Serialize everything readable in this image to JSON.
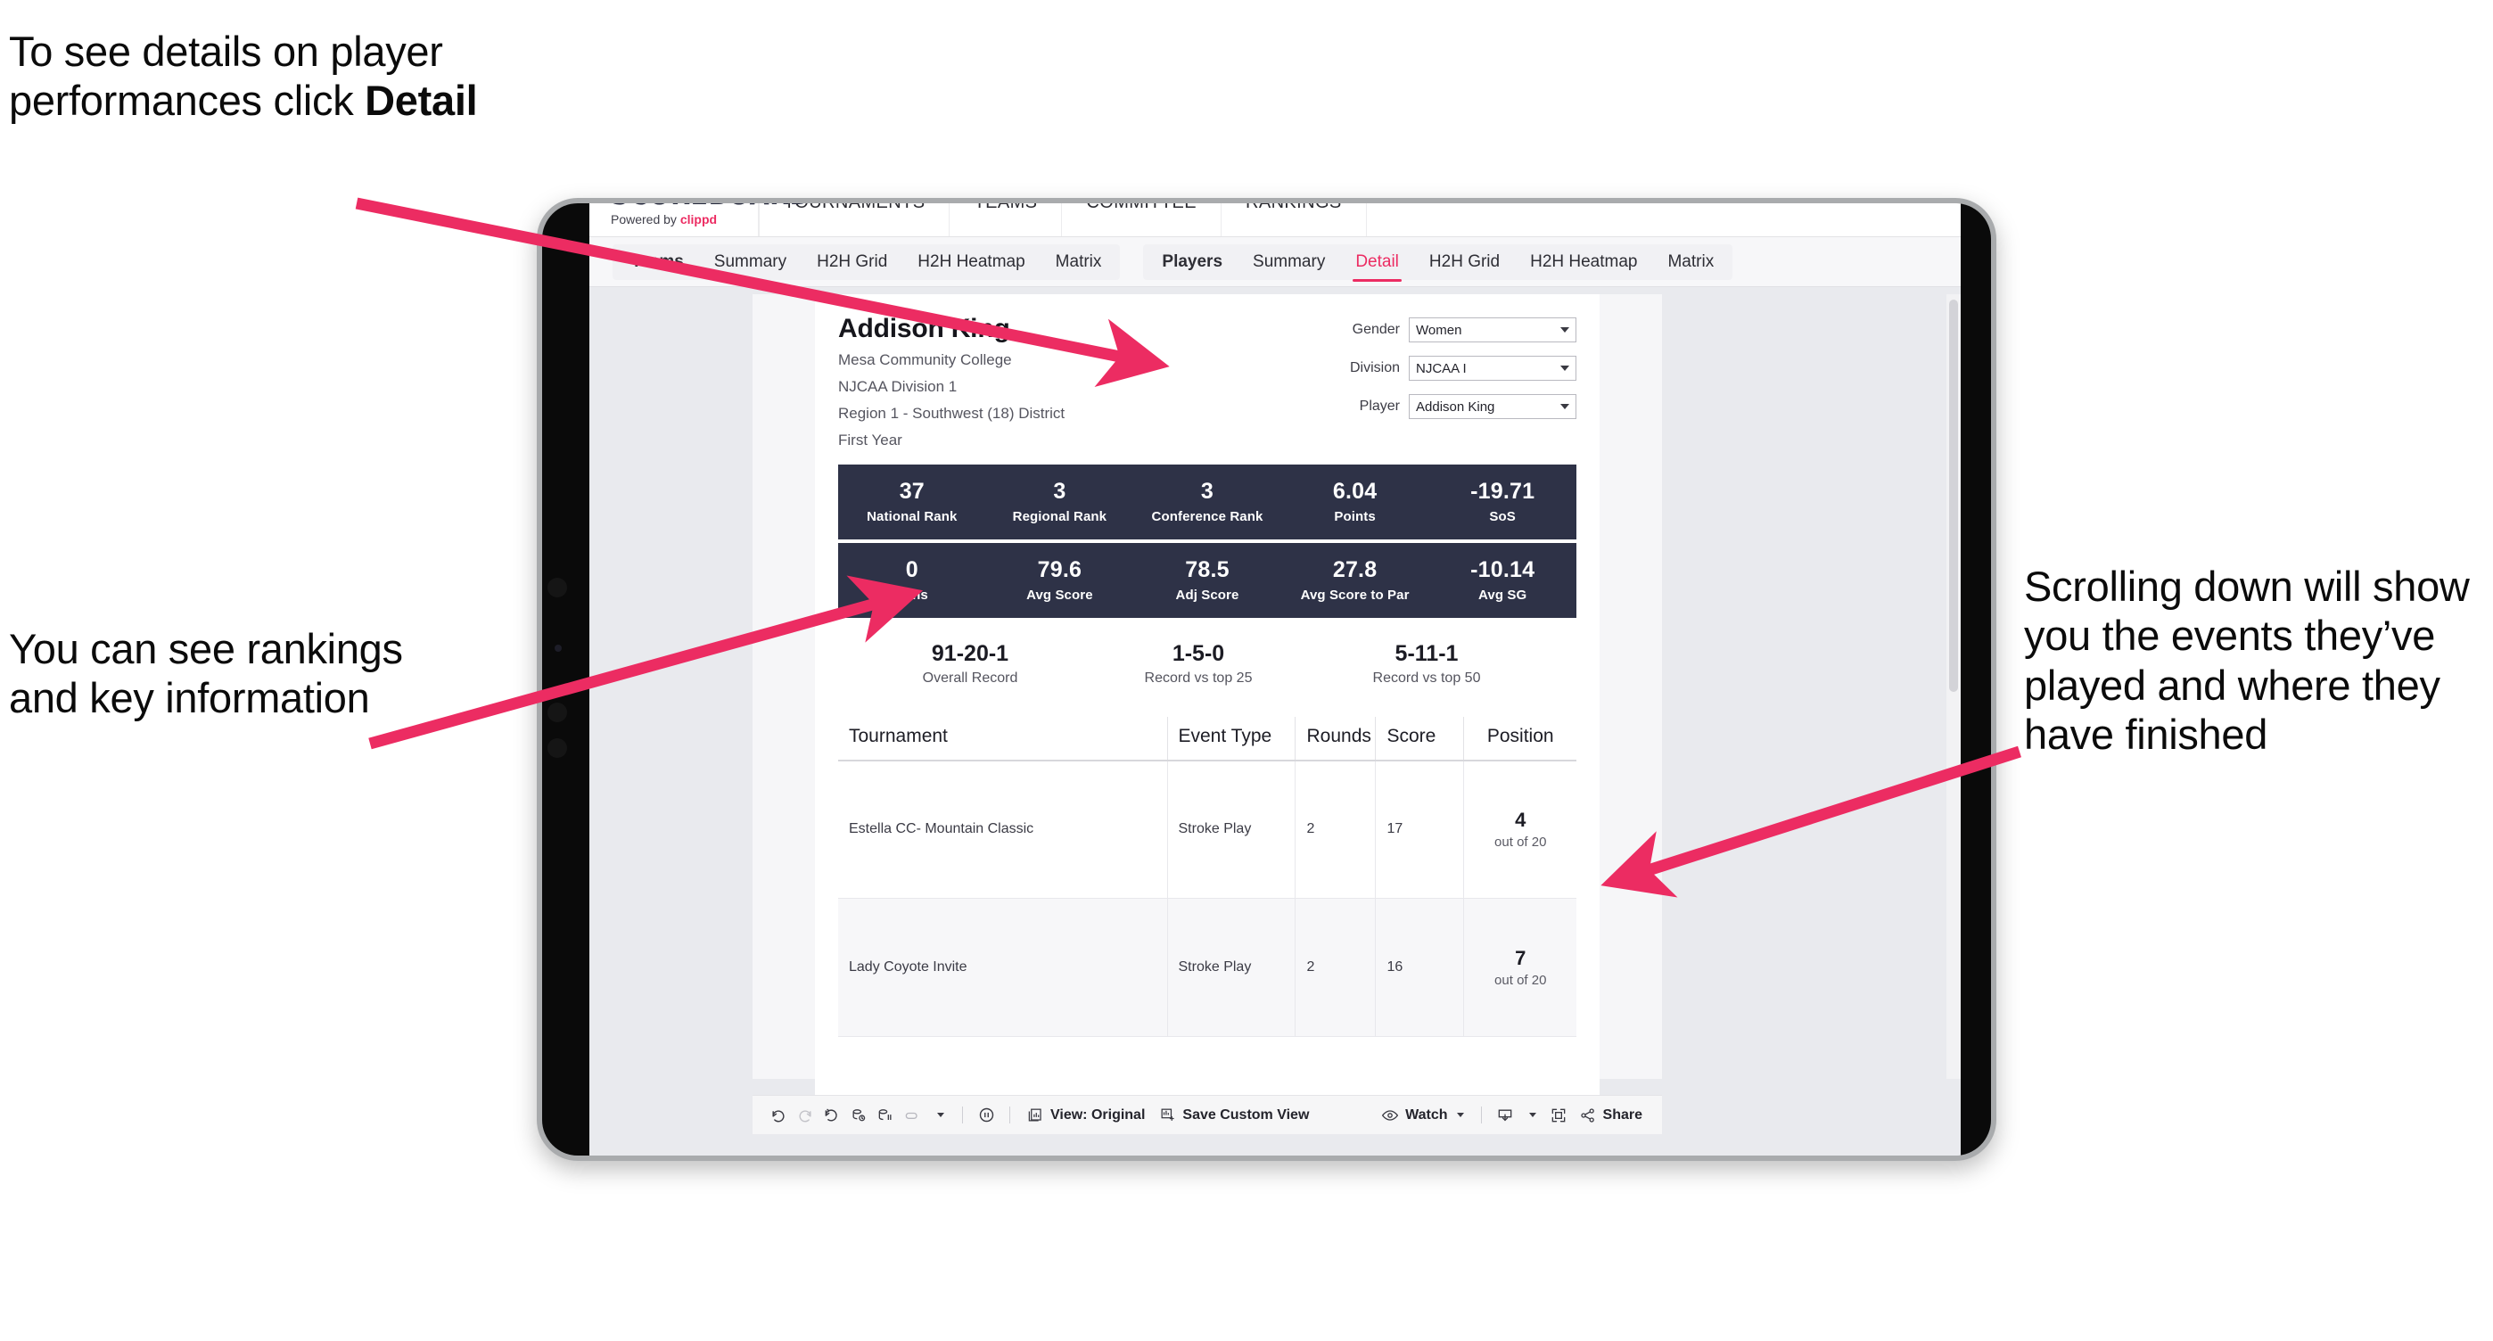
{
  "annotations": {
    "top_left": "To see details on player performances click ",
    "top_left_bold": "Detail",
    "mid_left": "You can see rankings and key information",
    "right": "Scrolling down will show you the events they’ve played and where they have finished"
  },
  "app": {
    "logo": {
      "main": "SCOREBOARD",
      "powered_prefix": "Powered by ",
      "brand": "clippd"
    },
    "top_nav": [
      "TOURNAMENTS",
      "TEAMS",
      "COMMITTEE",
      "RANKINGS"
    ],
    "tab_groups": [
      {
        "head": "Teams",
        "tabs": [
          "Summary",
          "H2H Grid",
          "H2H Heatmap",
          "Matrix"
        ]
      },
      {
        "head": "Players",
        "tabs": [
          "Summary",
          "Detail",
          "H2H Grid",
          "H2H Heatmap",
          "Matrix"
        ],
        "active": "Detail"
      }
    ],
    "player": {
      "name": "Addison King",
      "school": "Mesa Community College",
      "division": "NJCAA Division 1",
      "region": "Region 1 - Southwest (18) District",
      "year": "First Year"
    },
    "filters": [
      {
        "label": "Gender",
        "value": "Women"
      },
      {
        "label": "Division",
        "value": "NJCAA I"
      },
      {
        "label": "Player",
        "value": "Addison King"
      }
    ],
    "stat_band_1": [
      {
        "value": "37",
        "label": "National Rank"
      },
      {
        "value": "3",
        "label": "Regional Rank"
      },
      {
        "value": "3",
        "label": "Conference Rank"
      },
      {
        "value": "6.04",
        "label": "Points"
      },
      {
        "value": "-19.71",
        "label": "SoS"
      }
    ],
    "stat_band_2": [
      {
        "value": "0",
        "label": "Wins"
      },
      {
        "value": "79.6",
        "label": "Avg Score"
      },
      {
        "value": "78.5",
        "label": "Adj Score"
      },
      {
        "value": "27.8",
        "label": "Avg Score to Par"
      },
      {
        "value": "-10.14",
        "label": "Avg SG"
      }
    ],
    "records": [
      {
        "value": "91-20-1",
        "label": "Overall Record"
      },
      {
        "value": "1-5-0",
        "label": "Record vs top 25"
      },
      {
        "value": "5-11-1",
        "label": "Record vs top 50"
      }
    ],
    "events_table": {
      "headers": [
        "Tournament",
        "Event Type",
        "Rounds",
        "Score",
        "Position"
      ],
      "rows": [
        {
          "tournament": "Estella CC- Mountain Classic",
          "event_type": "Stroke Play",
          "rounds": "2",
          "score": "17",
          "position": "4",
          "position_sub": "out of 20"
        },
        {
          "tournament": "Lady Coyote Invite",
          "event_type": "Stroke Play",
          "rounds": "2",
          "score": "16",
          "position": "7",
          "position_sub": "out of 20"
        }
      ]
    },
    "toolbar": {
      "view_label": "View: Original",
      "save_label": "Save Custom View",
      "watch_label": "Watch",
      "share_label": "Share"
    }
  },
  "colors": {
    "accent": "#ec2c62",
    "band": "#2e3247",
    "page_bg": "#e9eaee"
  }
}
